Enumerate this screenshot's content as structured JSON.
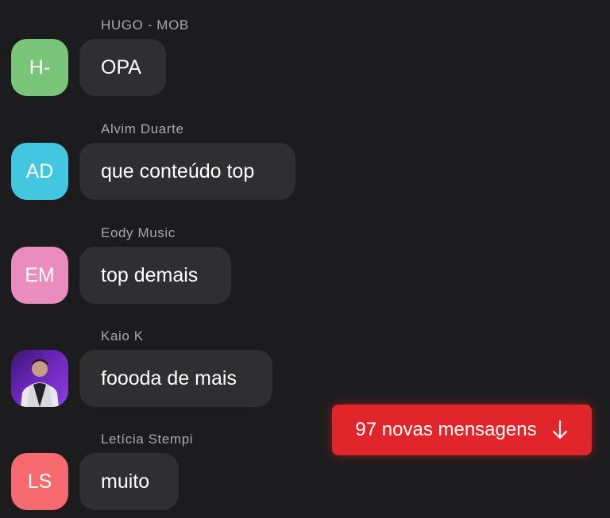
{
  "messages": [
    {
      "sender": "HUGO - MOB",
      "initials": "H-",
      "text": "OPA",
      "avatar_color": "#79c67a"
    },
    {
      "sender": "Alvim Duarte",
      "initials": "AD",
      "text": "que conteúdo top",
      "avatar_color": "#43c7e0"
    },
    {
      "sender": "Eody Music",
      "initials": "EM",
      "text": "top demais",
      "avatar_color": "#ea8dbe"
    },
    {
      "sender": "Kaio K",
      "initials": "",
      "text": "foooda de mais",
      "avatar_color": "#6a26b8",
      "avatar_icon": "profile-photo-icon"
    },
    {
      "sender": "Letícia Stempi",
      "initials": "LS",
      "text": "muito",
      "avatar_color": "#f46a6f"
    }
  ],
  "new_messages_button": {
    "label": "97 novas mensagens",
    "icon": "arrow-down-icon",
    "color": "#e0262a"
  },
  "colors": {
    "background": "#1c1c1e",
    "bubble": "#2f2f31",
    "sender_name": "#a8a8ad",
    "text": "#ffffff"
  }
}
